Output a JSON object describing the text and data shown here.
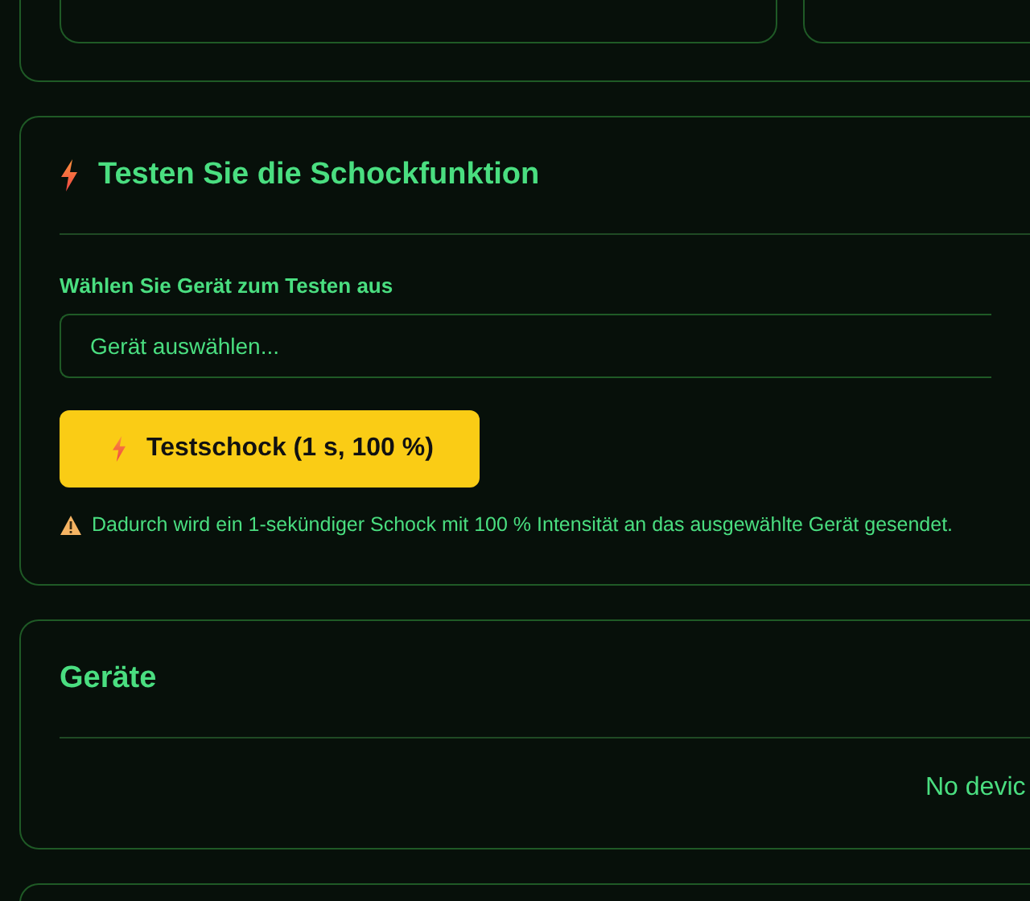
{
  "shock_test": {
    "title": "Testen Sie die Schockfunktion",
    "select_label": "Wählen Sie Gerät zum Testen aus",
    "select": {
      "placeholder": "Gerät auswählen..."
    },
    "button": "Testschock (1 s, 100 %)",
    "warning": "Dadurch wird ein 1-sekündiger Schock mit 100 % Intensität an das ausgewählte Gerät gesendet."
  },
  "devices": {
    "title": "Geräte",
    "empty_text": "No devic"
  }
}
